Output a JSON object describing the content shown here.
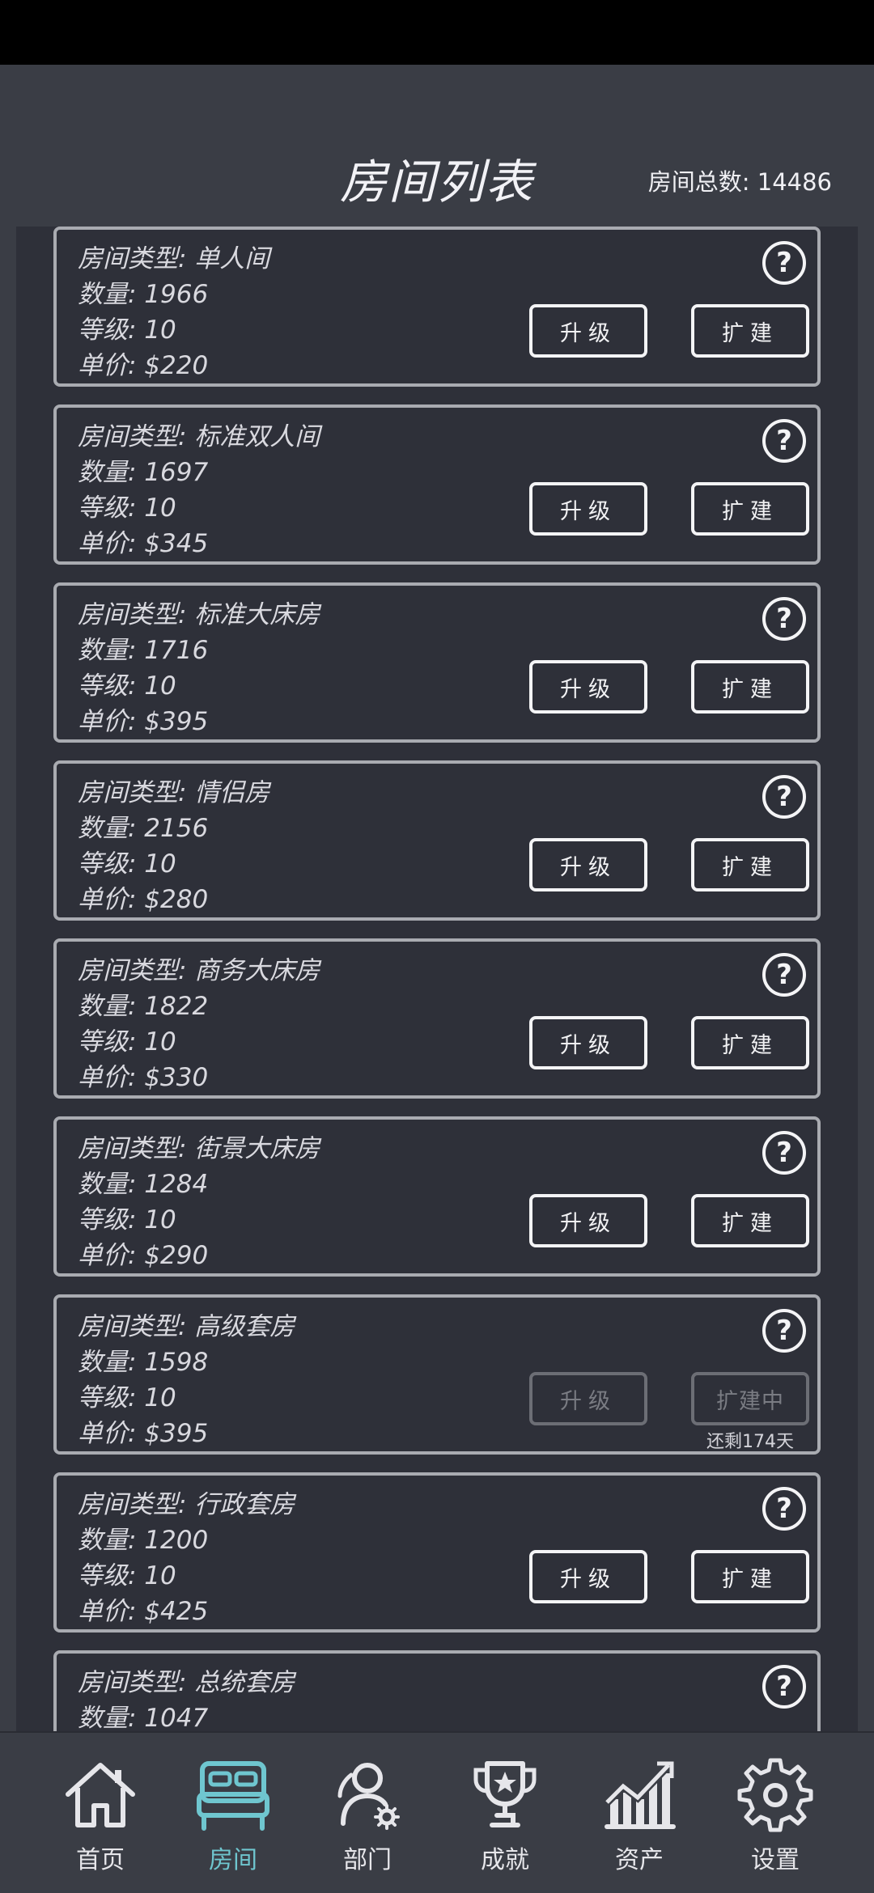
{
  "header": {
    "title": "房间列表",
    "total_label": "房间总数: 14486"
  },
  "rooms": [
    {
      "type": "房间类型: 单人间",
      "count": "数量: 1966",
      "level": "等级: 10",
      "price": "单价: $220",
      "upgrade": "升级",
      "expand": "扩建",
      "help": "?"
    },
    {
      "type": "房间类型: 标准双人间",
      "count": "数量: 1697",
      "level": "等级: 10",
      "price": "单价: $345",
      "upgrade": "升级",
      "expand": "扩建",
      "help": "?"
    },
    {
      "type": "房间类型: 标准大床房",
      "count": "数量: 1716",
      "level": "等级: 10",
      "price": "单价: $395",
      "upgrade": "升级",
      "expand": "扩建",
      "help": "?"
    },
    {
      "type": "房间类型: 情侣房",
      "count": "数量: 2156",
      "level": "等级: 10",
      "price": "单价: $280",
      "upgrade": "升级",
      "expand": "扩建",
      "help": "?"
    },
    {
      "type": "房间类型: 商务大床房",
      "count": "数量: 1822",
      "level": "等级: 10",
      "price": "单价: $330",
      "upgrade": "升级",
      "expand": "扩建",
      "help": "?"
    },
    {
      "type": "房间类型: 街景大床房",
      "count": "数量: 1284",
      "level": "等级: 10",
      "price": "单价: $290",
      "upgrade": "升级",
      "expand": "扩建",
      "help": "?"
    },
    {
      "type": "房间类型: 高级套房",
      "count": "数量: 1598",
      "level": "等级: 10",
      "price": "单价: $395",
      "upgrade": "升级",
      "expand": "扩建中",
      "remaining": "还剩174天",
      "help": "?"
    },
    {
      "type": "房间类型: 行政套房",
      "count": "数量: 1200",
      "level": "等级: 10",
      "price": "单价: $425",
      "upgrade": "升级",
      "expand": "扩建",
      "help": "?"
    },
    {
      "type": "房间类型: 总统套房",
      "count": "数量: 1047",
      "help": "?"
    }
  ],
  "nav": {
    "items": [
      {
        "label": "首页",
        "icon": "house-icon"
      },
      {
        "label": "房间",
        "icon": "bed-icon",
        "active": true
      },
      {
        "label": "部门",
        "icon": "people-gear-icon"
      },
      {
        "label": "成就",
        "icon": "trophy-icon"
      },
      {
        "label": "资产",
        "icon": "growth-chart-icon"
      },
      {
        "label": "设置",
        "icon": "gear-icon"
      }
    ]
  },
  "colors": {
    "accent": "#6fc6cf",
    "background": "#3a3d45",
    "panel": "#2e3039",
    "card_border": "#a9abb1"
  }
}
